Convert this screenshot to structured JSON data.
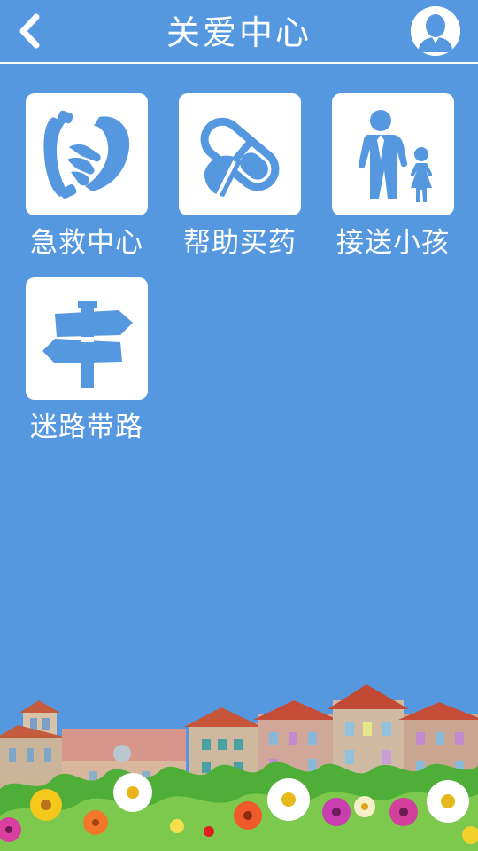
{
  "header": {
    "title": "关爱中心"
  },
  "icons": {
    "back": "chevron-left-icon",
    "avatar": "user-avatar-icon"
  },
  "menu": [
    {
      "id": "emergency",
      "label": "急救中心",
      "icon": "phone-handset-icon"
    },
    {
      "id": "medicine",
      "label": "帮助买药",
      "icon": "medicine-pill-icon"
    },
    {
      "id": "pickup",
      "label": "接送小孩",
      "icon": "adult-and-child-icon"
    },
    {
      "id": "directions",
      "label": "迷路带路",
      "icon": "signpost-icon"
    }
  ],
  "colors": {
    "background": "#5598df",
    "tile": "#ffffff",
    "icon": "#5598df"
  }
}
